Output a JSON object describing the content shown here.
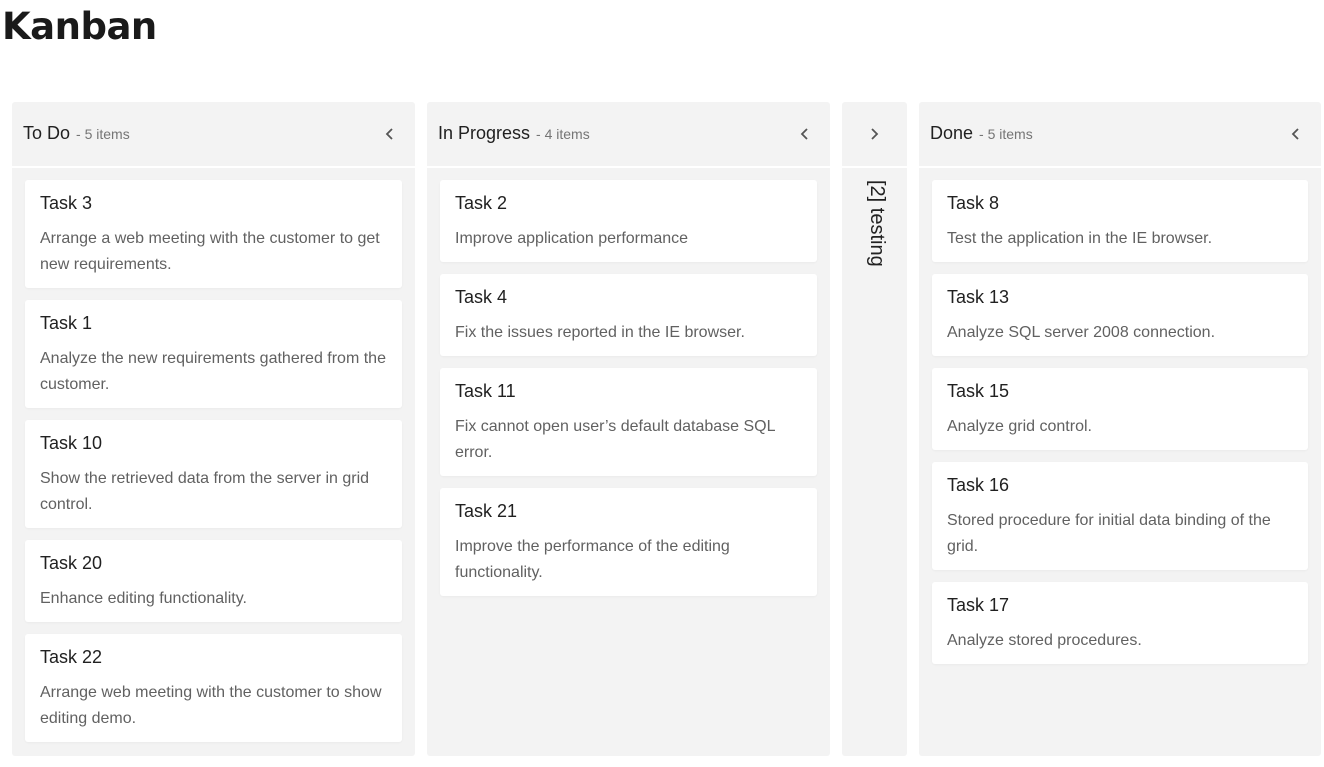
{
  "page": {
    "title": "Kanban"
  },
  "columns": [
    {
      "header": "To Do",
      "count": "- 5 items",
      "collapsed": false,
      "cards": [
        {
          "title": "Task 3",
          "content": "Arrange a web meeting with the customer to get new requirements."
        },
        {
          "title": "Task 1",
          "content": "Analyze the new requirements gathered from the customer."
        },
        {
          "title": "Task 10",
          "content": "Show the retrieved data from the server in grid control."
        },
        {
          "title": "Task 20",
          "content": "Enhance editing functionality."
        },
        {
          "title": "Task 22",
          "content": "Arrange web meeting with the customer to show editing demo."
        }
      ]
    },
    {
      "header": "In Progress",
      "count": "- 4 items",
      "collapsed": false,
      "cards": [
        {
          "title": "Task 2",
          "content": "Improve application performance"
        },
        {
          "title": "Task 4",
          "content": "Fix the issues reported in the IE browser."
        },
        {
          "title": "Task 11",
          "content": "Fix cannot open user’s default database SQL error."
        },
        {
          "title": "Task 21",
          "content": "Improve the performance of the editing functionality."
        }
      ]
    },
    {
      "header": "[2] testing",
      "collapsed": true
    },
    {
      "header": "Done",
      "count": "- 5 items",
      "collapsed": false,
      "cards": [
        {
          "title": "Task 8",
          "content": "Test the application in the IE browser."
        },
        {
          "title": "Task 13",
          "content": "Analyze SQL server 2008 connection."
        },
        {
          "title": "Task 15",
          "content": "Analyze grid control."
        },
        {
          "title": "Task 16",
          "content": "Stored procedure for initial data binding of the grid."
        },
        {
          "title": "Task 17",
          "content": "Analyze stored procedures."
        }
      ]
    }
  ],
  "icons": {
    "collapse": "chevron-left-icon",
    "expand": "chevron-right-icon"
  },
  "colors": {
    "column_bg": "#f3f3f3",
    "card_bg": "#ffffff",
    "text_primary": "#212121",
    "text_secondary": "#616161",
    "count_text": "#757575"
  }
}
